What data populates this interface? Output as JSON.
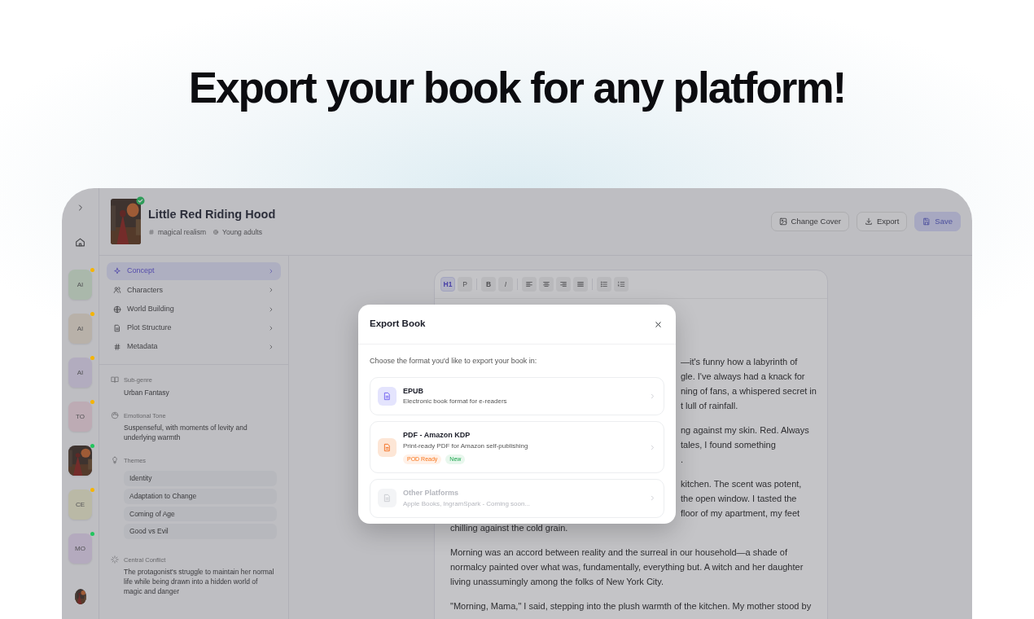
{
  "headline": "Export your book for any platform!",
  "rail": {
    "items": [
      {
        "kind": "initials",
        "label": "AI",
        "color": "#f5b400"
      },
      {
        "kind": "initials",
        "label": "AI",
        "color": "#f5b400"
      },
      {
        "kind": "initials",
        "label": "AI",
        "color": "#f5b400"
      },
      {
        "kind": "initials",
        "label": "TO",
        "color": "#f5b400"
      },
      {
        "kind": "picture",
        "color": "#22c55e"
      },
      {
        "kind": "initials",
        "label": "CE",
        "color": "#f5b400"
      },
      {
        "kind": "initials",
        "label": "MO",
        "color": "#22c55e"
      }
    ]
  },
  "book": {
    "title": "Little Red Riding Hood",
    "verified": true,
    "tags": [
      {
        "kind": "genre",
        "label": "magical realism"
      },
      {
        "kind": "audience",
        "label": "Young adults"
      }
    ]
  },
  "actions": [
    {
      "kind": "cover",
      "label": "Change Cover",
      "disabled": false
    },
    {
      "kind": "export",
      "label": "Export",
      "disabled": false
    },
    {
      "kind": "save",
      "label": "Save",
      "disabled": true
    }
  ],
  "nav": [
    {
      "kind": "concept",
      "label": "Concept",
      "selected": true
    },
    {
      "kind": "characters",
      "label": "Characters",
      "selected": false
    },
    {
      "kind": "world",
      "label": "World Building",
      "selected": false
    },
    {
      "kind": "plot",
      "label": "Plot Structure",
      "selected": false
    },
    {
      "kind": "metadata",
      "label": "Metadata",
      "selected": false
    }
  ],
  "fields": [
    {
      "kind": "subgenre",
      "label": "Sub-genre",
      "value": "Urban Fantasy"
    },
    {
      "kind": "tone",
      "label": "Emotional Tone",
      "value": "Suspenseful, with moments of levity and underlying warmth"
    },
    {
      "kind": "themes",
      "label": "Themes",
      "chips": [
        "Identity",
        "Adaptation to Change",
        "Coming of Age",
        "Good vs Evil"
      ]
    },
    {
      "kind": "conflict",
      "label": "Central Conflict",
      "value": "The protagonist's struggle to maintain her normal life while being drawn into a hidden world of magic and danger"
    }
  ],
  "toolbar": [
    {
      "kind": "h1",
      "label": "H1",
      "selected": true
    },
    {
      "kind": "p",
      "label": "P",
      "selected": false
    },
    {
      "kind": "bold",
      "label": "B",
      "selected": false
    },
    {
      "kind": "italic",
      "label": "I",
      "selected": false
    },
    {
      "kind": "align-left",
      "selected": false
    },
    {
      "kind": "align-center",
      "selected": false
    },
    {
      "kind": "align-right",
      "selected": false
    },
    {
      "kind": "align-justify",
      "selected": false
    },
    {
      "kind": "list-bullet",
      "selected": false
    },
    {
      "kind": "list-number",
      "selected": false
    }
  ],
  "editor": {
    "paragraphs": [
      [
        {
          "text": "—it's funny how a labyrinth of",
          "kind": "fragment"
        },
        {
          "text": "gle. I've always had a knack for",
          "kind": "fragment"
        },
        {
          "text": "ning of fans, a whispered secret in",
          "kind": "fragment"
        },
        {
          "text": "t lull of rainfall.",
          "kind": "fragment"
        }
      ],
      [
        {
          "text": "ng against my skin. Red. Always",
          "kind": "fragment"
        },
        {
          "text": "tales, I found something",
          "kind": "fragment"
        },
        {
          "text": ".",
          "kind": "fragment"
        }
      ],
      [
        {
          "text": "kitchen. The scent was potent,",
          "kind": "fragment"
        },
        {
          "text": "the open window. I tasted the",
          "kind": "fragment"
        },
        {
          "text": "floor of my apartment, my feet",
          "kind": "fragment"
        },
        {
          "text": "chilling against the cold grain.",
          "kind": "full"
        }
      ],
      [
        {
          "text": "Morning was an accord between reality and the surreal in our household—a shade of",
          "kind": "full"
        },
        {
          "text": "normalcy painted over what was, fundamentally, everything but. A witch and her daughter",
          "kind": "full"
        },
        {
          "text": "living unassumingly among the folks of New York City.",
          "kind": "full"
        }
      ],
      [
        {
          "text": "\"Morning, Mama,\" I said, stepping into the plush warmth of the kitchen. My mother stood by",
          "kind": "full"
        }
      ]
    ]
  },
  "modal": {
    "title": "Export Book",
    "prompt": "Choose the format you'd like to export your book in:",
    "options": [
      {
        "kind": "epub",
        "title": "EPUB",
        "description": "Electronic book format for e-readers",
        "disabled": false
      },
      {
        "kind": "pdf",
        "title": "PDF - Amazon KDP",
        "description": "Print-ready PDF for Amazon self-publishing",
        "disabled": false,
        "badges": [
          {
            "label": "POD Ready",
            "kind": "pod"
          },
          {
            "label": "New",
            "kind": "new"
          }
        ]
      },
      {
        "kind": "other",
        "title": "Other Platforms",
        "description": "Apple Books, IngramSpark - Coming soon...",
        "disabled": true
      }
    ]
  }
}
